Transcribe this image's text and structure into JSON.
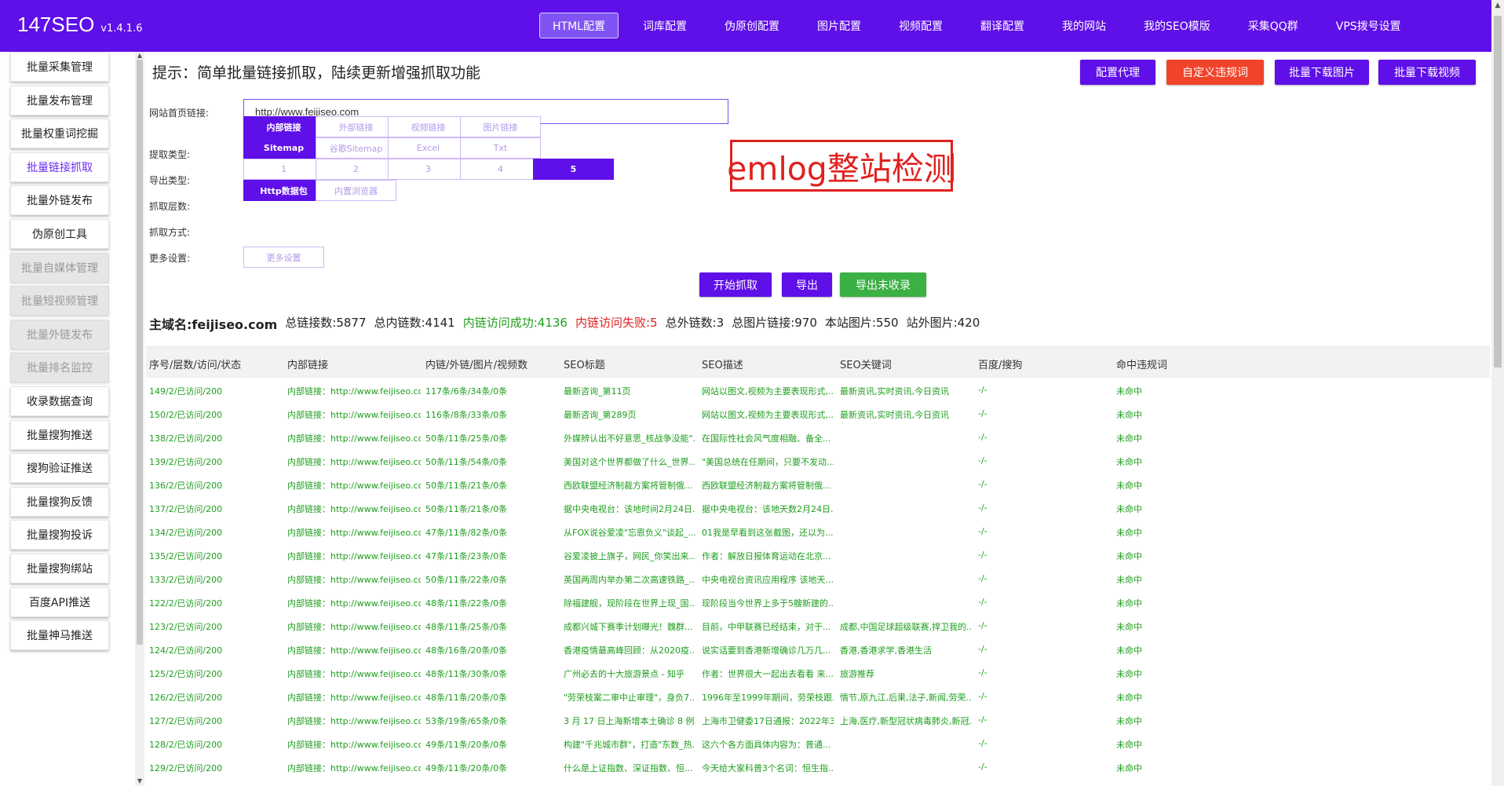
{
  "app": {
    "name": "147SEO",
    "version": "v1.4.1.6"
  },
  "topnav": [
    {
      "label": "HTML配置",
      "active": true
    },
    {
      "label": "词库配置"
    },
    {
      "label": "伪原创配置"
    },
    {
      "label": "图片配置"
    },
    {
      "label": "视频配置"
    },
    {
      "label": "翻译配置"
    },
    {
      "label": "我的网站"
    },
    {
      "label": "我的SEO模版"
    },
    {
      "label": "采集QQ群"
    },
    {
      "label": "VPS拨号设置"
    }
  ],
  "sidebar": [
    {
      "label": "批量采集管理"
    },
    {
      "label": "批量发布管理"
    },
    {
      "label": "批量权重词挖掘"
    },
    {
      "label": "批量链接抓取",
      "active": true
    },
    {
      "label": "批量外链发布"
    },
    {
      "label": "伪原创工具"
    },
    {
      "label": "批量自媒体管理",
      "disabled": true
    },
    {
      "label": "批量短视频管理",
      "disabled": true
    },
    {
      "label": "批量外链发布",
      "disabled": true
    },
    {
      "label": "批量排名监控",
      "disabled": true
    },
    {
      "label": "收录数据查询"
    },
    {
      "label": "批量搜狗推送"
    },
    {
      "label": "搜狗验证推送"
    },
    {
      "label": "批量搜狗反馈"
    },
    {
      "label": "批量搜狗投诉"
    },
    {
      "label": "批量搜狗绑站"
    },
    {
      "label": "百度API推送"
    },
    {
      "label": "批量神马推送"
    }
  ],
  "hint": "提示：简单批量链接抓取，陆续更新增强抓取功能",
  "actions": {
    "proxy": "配置代理",
    "custom_words": "自定义违规词",
    "download_images": "批量下载图片",
    "download_videos": "批量下载视频"
  },
  "colors": {
    "primary": "#5f0fe8",
    "danger": "#f0442a",
    "success": "#3bb044"
  },
  "form": {
    "url_label": "网站首页链接:",
    "url_value": "http://www.feijiseo.com",
    "extract_label": "提取类型:",
    "extract_options": [
      "内部链接",
      "外部链接",
      "视频链接",
      "图片链接"
    ],
    "export_label": "导出类型:",
    "export_options": [
      "Sitemap",
      "谷歌Sitemap",
      "Excel",
      "Txt"
    ],
    "depth_label": "抓取层数:",
    "depth_options": [
      "1",
      "2",
      "3",
      "4",
      "5"
    ],
    "method_label": "抓取方式:",
    "method_options": [
      "Http数据包",
      "内置浏览器"
    ],
    "more_label": "更多设置:",
    "more_button": "更多设置"
  },
  "promo_text": "emlog整站检测",
  "buttons": {
    "start": "开始抓取",
    "export": "导出",
    "export_unindexed": "导出未收录"
  },
  "stats": {
    "domain": "主域名:feijiseo.com",
    "total_links": "总链接数:5877",
    "internal_links": "总内链数:4141",
    "internal_ok": "内链访问成功:4136",
    "internal_fail": "内链访问失败:5",
    "external_links": "总外链数:3",
    "image_links": "总图片链接:970",
    "site_images": "本站图片:550",
    "external_images": "站外图片:420"
  },
  "table": {
    "headers": [
      "序号/层数/访问/状态",
      "内部链接",
      "内链/外链/图片/视频数",
      "SEO标题",
      "SEO描述",
      "SEO关键词",
      "百度/搜狗",
      "命中违规词"
    ],
    "rows": [
      [
        "149/2/已访问/200",
        "内部链接：http://www.feijiseo.com/inde",
        "117条/6条/34条/0条",
        "最新咨询_第11页",
        "网站以图文,视频为主要表现形式,...",
        "最新资讯,实时资讯,今日资讯",
        "-/-",
        "未命中"
      ],
      [
        "150/2/已访问/200",
        "内部链接：http://www.feijiseo.com/inde",
        "116条/8条/33条/0条",
        "最新咨询_第289页",
        "网站以图文,视频为主要表现形式,...",
        "最新资讯,实时资讯,今日资讯",
        "-/-",
        "未命中"
      ],
      [
        "138/2/已访问/200",
        "内部链接：http://www.feijiseo.com/inde",
        "50条/11条/25条/0条",
        "外媒辨认出不好意思_核战争没能\"...",
        "在国际性社会风气度相融、备全...",
        "",
        "-/-",
        "未命中"
      ],
      [
        "139/2/已访问/200",
        "内部链接：http://www.feijiseo.com/inde",
        "50条/11条/54条/0条",
        "美国对这个世界都做了什么_世界...",
        "\"美国总统在任期间，只要不发动...",
        "",
        "-/-",
        "未命中"
      ],
      [
        "136/2/已访问/200",
        "内部链接：http://www.feijiseo.com/inde",
        "50条/11条/21条/0条",
        "西欧联盟经济制裁方案将管制俄...",
        "西欧联盟经济制裁方案将管制俄...",
        "",
        "-/-",
        "未命中"
      ],
      [
        "137/2/已访问/200",
        "内部链接：http://www.feijiseo.com/inde",
        "50条/11条/21条/0条",
        "据中央电视台：该地时间2月24日...",
        "据中央电视台：该地天数2月24日...",
        "",
        "-/-",
        "未命中"
      ],
      [
        "134/2/已访问/200",
        "内部链接：http://www.feijiseo.com/inde",
        "47条/11条/82条/0条",
        "从FOX说谷爱凌\"忘恩负义\"谈起_...",
        "01我是早看到这张截图，还以为...",
        "",
        "-/-",
        "未命中"
      ],
      [
        "135/2/已访问/200",
        "内部链接：http://www.feijiseo.com/inde",
        "47条/11条/23条/0条",
        "谷爱凌披上旗子，网民_你笑出来...",
        "作者：解放日报体育运动在北京...",
        "",
        "-/-",
        "未命中"
      ],
      [
        "133/2/已访问/200",
        "内部链接：http://www.feijiseo.com/inde",
        "50条/11条/22条/0条",
        "英国两周内举办第二次高速铁路_...",
        "中央电视台资讯应用程序 该地天...",
        "",
        "-/-",
        "未命中"
      ],
      [
        "122/2/已访问/200",
        "内部链接：http://www.feijiseo.com/inde",
        "48条/11条/22条/0条",
        "除福建舰，现阶段在世界上现_国...",
        "现阶段当今世界上多于5艘新建的...",
        "",
        "-/-",
        "未命中"
      ],
      [
        "123/2/已访问/200",
        "内部链接：http://www.feijiseo.com/inde",
        "48条/11条/25条/0条",
        "成都兴城下赛季计划曝光！魏群...",
        "目前，中甲联赛已经结束，对于...",
        "成都,中国足球超级联赛,捍卫我的...",
        "-/-",
        "未命中"
      ],
      [
        "124/2/已访问/200",
        "内部链接：http://www.feijiseo.com/inde",
        "48条/16条/20条/0条",
        "香港疫情最高峰回顾：从2020疫...",
        "说实话要到香港新增确诊几万几...",
        "香港,香港求学,香港生活",
        "-/-",
        "未命中"
      ],
      [
        "125/2/已访问/200",
        "内部链接：http://www.feijiseo.com/inde",
        "48条/11条/30条/0条",
        "广州必去的十大旅游景点 - 知乎",
        "作者：世界很大一起出去看看 来...",
        "旅游推荐",
        "-/-",
        "未命中"
      ],
      [
        "126/2/已访问/200",
        "内部链接：http://www.feijiseo.com/inde",
        "48条/11条/20条/0条",
        "\"劳荣枝案二审中止审理\"，身负7...",
        "1996年至1999年期间，劳荣枝跟...",
        "情节,原九江,后果,法子,新闻,劳荣...",
        "-/-",
        "未命中"
      ],
      [
        "127/2/已访问/200",
        "内部链接：http://www.feijiseo.com/inde",
        "53条/19条/65条/0条",
        "3 月 17 日上海新增本土确诊 8 例...",
        "上海市卫健委17日通报：2022年3...",
        "上海,医疗,新型冠状病毒肺炎,新冠...",
        "-/-",
        "未命中"
      ],
      [
        "128/2/已访问/200",
        "内部链接：http://www.feijiseo.com/inde",
        "49条/11条/20条/0条",
        "构建\"千兆城市群\"，打造\"东数_热...",
        "这六个各方面具体内容为：普通...",
        "",
        "-/-",
        "未命中"
      ],
      [
        "129/2/已访问/200",
        "内部链接：http://www.feijiseo.com/inde",
        "49条/11条/20条/0条",
        "什么是上证指数、深证指数、恒...",
        "今天给大家科普3个名词：恒生指...",
        "",
        "-/-",
        "未命中"
      ]
    ]
  }
}
